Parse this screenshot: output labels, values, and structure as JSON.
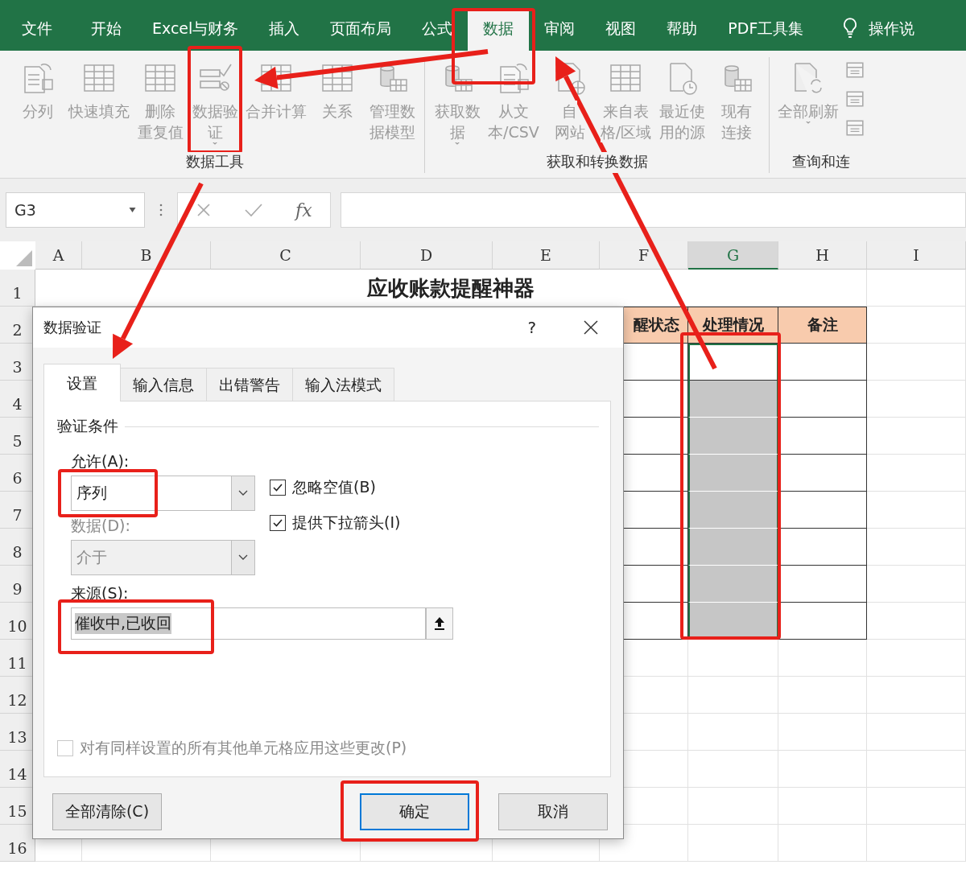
{
  "menu_tabs": [
    {
      "label": "文件",
      "selected": false,
      "highlighted": false
    },
    {
      "label": "开始",
      "selected": false,
      "highlighted": false
    },
    {
      "label": "Excel与财务",
      "selected": false,
      "highlighted": false
    },
    {
      "label": "插入",
      "selected": false,
      "highlighted": false
    },
    {
      "label": "页面布局",
      "selected": false,
      "highlighted": false
    },
    {
      "label": "公式",
      "selected": false,
      "highlighted": false
    },
    {
      "label": "数据",
      "selected": true,
      "highlighted": true
    },
    {
      "label": "审阅",
      "selected": false,
      "highlighted": false
    },
    {
      "label": "视图",
      "selected": false,
      "highlighted": false
    },
    {
      "label": "帮助",
      "selected": false,
      "highlighted": false
    },
    {
      "label": "PDF工具集",
      "selected": false,
      "highlighted": false
    }
  ],
  "tell_me": {
    "label": "操作说"
  },
  "ribbon": {
    "groups": [
      {
        "label": "数据工具",
        "items": [
          {
            "kind": "large",
            "lines": [
              "分列"
            ],
            "dropdown": false,
            "highlighted": false
          },
          {
            "kind": "large",
            "lines": [
              "快速填充"
            ],
            "dropdown": false,
            "highlighted": false
          },
          {
            "kind": "large",
            "lines": [
              "删除",
              "重复值"
            ],
            "dropdown": false,
            "highlighted": false
          },
          {
            "kind": "large",
            "lines": [
              "数据验",
              "证"
            ],
            "dropdown": true,
            "highlighted": true
          },
          {
            "kind": "large",
            "lines": [
              "合并计算"
            ],
            "dropdown": false,
            "highlighted": false
          },
          {
            "kind": "large",
            "lines": [
              "关系"
            ],
            "dropdown": false,
            "highlighted": false
          },
          {
            "kind": "large",
            "lines": [
              "管理数",
              "据模型"
            ],
            "dropdown": false,
            "highlighted": false
          }
        ]
      },
      {
        "label": "获取和转换数据",
        "items": [
          {
            "kind": "large",
            "lines": [
              "获取数",
              "据"
            ],
            "dropdown": true,
            "highlighted": false
          },
          {
            "kind": "large",
            "lines": [
              "从文",
              "本/CSV"
            ],
            "dropdown": false,
            "highlighted": false
          },
          {
            "kind": "large",
            "lines": [
              "自",
              "网站"
            ],
            "dropdown": false,
            "highlighted": false
          },
          {
            "kind": "large",
            "lines": [
              "来自表",
              "格/区域"
            ],
            "dropdown": false,
            "highlighted": false
          },
          {
            "kind": "large",
            "lines": [
              "最近使",
              "用的源"
            ],
            "dropdown": false,
            "highlighted": false
          },
          {
            "kind": "large",
            "lines": [
              "现有",
              "连接"
            ],
            "dropdown": false,
            "highlighted": false
          }
        ]
      },
      {
        "label": "查询和连",
        "items": [
          {
            "kind": "large",
            "lines": [
              "全部刷新"
            ],
            "dropdown": true,
            "highlighted": false
          },
          {
            "kind": "small",
            "highlighted": false
          },
          {
            "kind": "small",
            "highlighted": false
          },
          {
            "kind": "small",
            "highlighted": false
          }
        ]
      }
    ]
  },
  "formula_bar": {
    "name_box": "G3",
    "function_label": "fx"
  },
  "sheet": {
    "columns": [
      {
        "label": "A",
        "selected": false
      },
      {
        "label": "B",
        "selected": false
      },
      {
        "label": "C",
        "selected": false
      },
      {
        "label": "D",
        "selected": false
      },
      {
        "label": "E",
        "selected": false
      },
      {
        "label": "F",
        "selected": false
      },
      {
        "label": "G",
        "selected": true
      },
      {
        "label": "H",
        "selected": false
      },
      {
        "label": "I",
        "selected": false
      }
    ],
    "rows": [
      "1",
      "2",
      "3",
      "4",
      "5",
      "6",
      "7",
      "8",
      "9",
      "10",
      "11",
      "12",
      "13",
      "14",
      "15",
      "16"
    ],
    "title": "应收账款提醒神器",
    "table": {
      "header": [
        "醒状态",
        "处理情况",
        "备注"
      ],
      "selection_highlighted": true,
      "rows": [
        {
          "cells": [
            {
              "selected": false,
              "active": false
            },
            {
              "selected": true,
              "active": true
            },
            {
              "selected": false,
              "active": false
            }
          ]
        },
        {
          "cells": [
            {
              "selected": false,
              "active": false
            },
            {
              "selected": true,
              "active": false
            },
            {
              "selected": false,
              "active": false
            }
          ]
        },
        {
          "cells": [
            {
              "selected": false,
              "active": false
            },
            {
              "selected": true,
              "active": false
            },
            {
              "selected": false,
              "active": false
            }
          ]
        },
        {
          "cells": [
            {
              "selected": false,
              "active": false
            },
            {
              "selected": true,
              "active": false
            },
            {
              "selected": false,
              "active": false
            }
          ]
        },
        {
          "cells": [
            {
              "selected": false,
              "active": false
            },
            {
              "selected": true,
              "active": false
            },
            {
              "selected": false,
              "active": false
            }
          ]
        },
        {
          "cells": [
            {
              "selected": false,
              "active": false
            },
            {
              "selected": true,
              "active": false
            },
            {
              "selected": false,
              "active": false
            }
          ]
        },
        {
          "cells": [
            {
              "selected": false,
              "active": false
            },
            {
              "selected": true,
              "active": false
            },
            {
              "selected": false,
              "active": false
            }
          ]
        },
        {
          "cells": [
            {
              "selected": false,
              "active": false
            },
            {
              "selected": true,
              "active": false
            },
            {
              "selected": false,
              "active": false
            }
          ]
        }
      ]
    }
  },
  "dialog": {
    "title": "数据验证",
    "help": "?",
    "tabs": [
      {
        "label": "设置",
        "selected": true
      },
      {
        "label": "输入信息",
        "selected": false
      },
      {
        "label": "出错警告",
        "selected": false
      },
      {
        "label": "输入法模式",
        "selected": false
      }
    ],
    "section": "验证条件",
    "allow": {
      "label": "允许(A):",
      "value": "序列",
      "highlighted": true
    },
    "options": [
      {
        "label": "忽略空值(B)",
        "checked": true
      },
      {
        "label": "提供下拉箭头(I)",
        "checked": true
      }
    ],
    "data": {
      "label": "数据(D):",
      "value": "介于",
      "disabled": true
    },
    "source": {
      "label": "来源(S):",
      "value": "催收中,已收回",
      "highlighted": true
    },
    "apply_all": {
      "label": "对有同样设置的所有其他单元格应用这些更改(P)",
      "checked": false,
      "disabled": true
    },
    "buttons": [
      {
        "label": "全部清除(C)",
        "kind": "normal",
        "highlighted": false
      },
      {
        "label": "确定",
        "kind": "default",
        "highlighted": true
      },
      {
        "label": "取消",
        "kind": "normal",
        "highlighted": false
      }
    ]
  }
}
